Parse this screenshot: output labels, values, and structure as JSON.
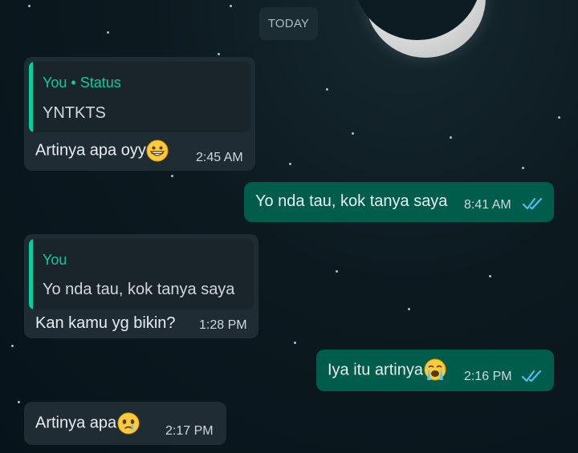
{
  "chat": {
    "date_label": "TODAY",
    "messages": [
      {
        "reply_author": "You",
        "reply_separator": "•",
        "reply_context": "Status",
        "reply_text": "YNTKTS",
        "text": "Artinya apa oyy",
        "emoji": "grinning-face-icon",
        "time": "2:45 AM"
      },
      {
        "text": "Yo nda tau, kok tanya saya",
        "time": "8:41 AM",
        "status": "read"
      },
      {
        "reply_author": "You",
        "reply_text": "Yo nda tau, kok tanya saya",
        "text": "Kan kamu yg bikin?",
        "time": "1:28 PM"
      },
      {
        "text": "Iya itu artinya",
        "emoji": "loudly-crying-face-icon",
        "time": "2:16 PM",
        "status": "read"
      },
      {
        "text": "Artinya apa",
        "emoji": "face-holding-back-tears-icon",
        "time": "2:17 PM"
      }
    ]
  },
  "colors": {
    "incoming_bubble": "#1f2c34",
    "outgoing_bubble": "#005c4b",
    "accent": "#06cf9c",
    "read_ticks": "#53bdeb"
  }
}
